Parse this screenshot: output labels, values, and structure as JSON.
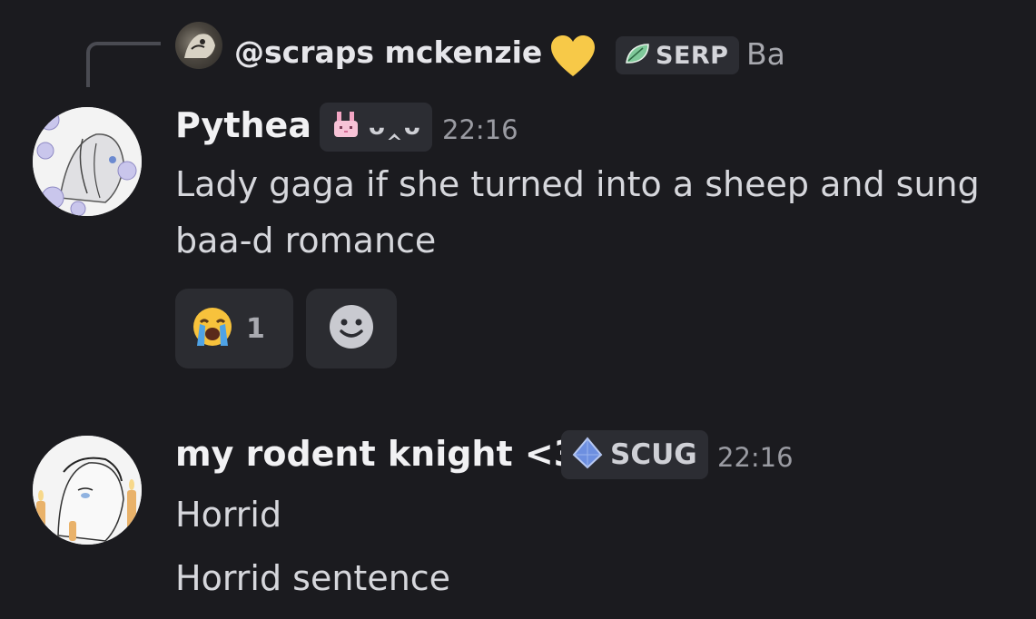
{
  "reply": {
    "author": "@scraps mckenzie",
    "tag_label": "SERP",
    "preview": "Ba",
    "heart_icon": "yellow-heart-icon",
    "tag_icon": "leaf-icon"
  },
  "messages": [
    {
      "author": "Pythea",
      "tag_face": "ᴗ‸ᴗ",
      "tag_icon": "bunny-icon",
      "time": "22:16",
      "lines": [
        "Lady gaga if she turned into a sheep and sung baa-d romance"
      ],
      "reactions": [
        {
          "emoji_icon": "loudly-crying-face-icon",
          "count": "1"
        }
      ]
    },
    {
      "author": "my rodent knight <3",
      "tag_label": "SCUG",
      "tag_icon": "blue-gem-icon",
      "time": "22:16",
      "lines": [
        "Horrid",
        "Horrid sentence"
      ]
    }
  ],
  "colors": {
    "background": "#1b1b1f",
    "tag_bg": "#2c2d33",
    "name": "#f1f1f3",
    "text": "#d6d7dc",
    "muted": "#9a9ba2",
    "heart": "#f7c948",
    "gem": "#6d8fe0"
  }
}
